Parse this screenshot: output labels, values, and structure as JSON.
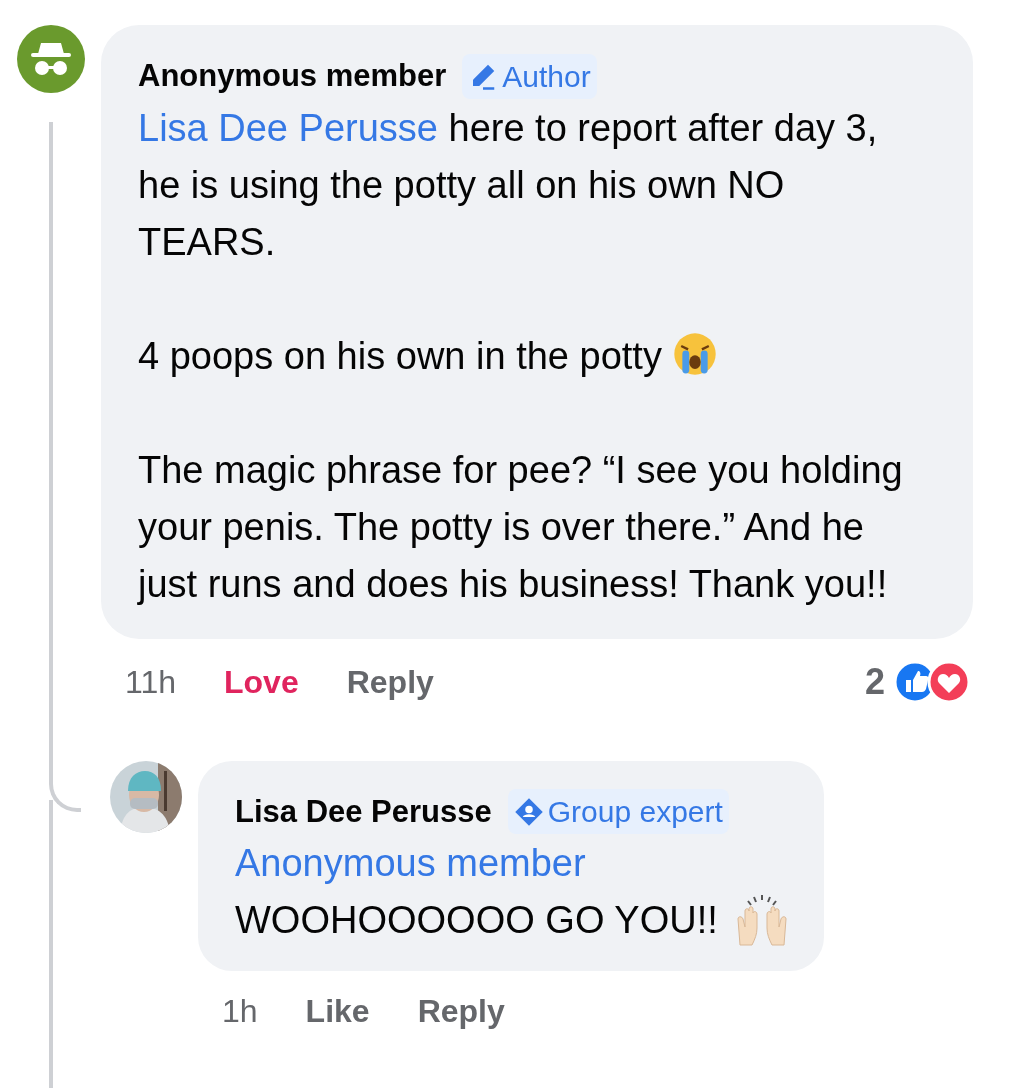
{
  "comment": {
    "author": "Anonymous member",
    "badge": {
      "kind": "author",
      "label": "Author"
    },
    "mention": "Lisa Dee Perusse",
    "paragraphs": [
      "here to report after day 3, he is using the potty all on his own NO TEARS.",
      "4 poops on his own in the potty",
      "The magic phrase for pee? “I see you holding your penis. The potty is over there.” And he just runs and does his business! Thank you!!"
    ],
    "time": "11h",
    "reaction": {
      "label": "Love",
      "selected": true
    },
    "reply_label": "Reply",
    "reaction_count": "2"
  },
  "reply": {
    "author": "Lisa Dee Perusse",
    "badge": {
      "kind": "expert",
      "label": "Group expert"
    },
    "mention": "Anonymous member",
    "text": "WOOHOOOOOO GO YOU!!",
    "time": "1h",
    "reaction": {
      "label": "Like",
      "selected": false
    },
    "reply_label": "Reply"
  }
}
